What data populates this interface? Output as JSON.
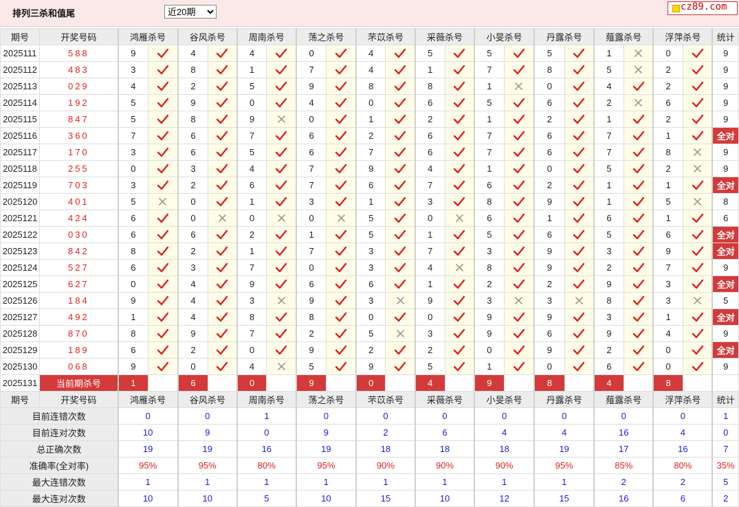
{
  "header": {
    "title": "排列三杀和值尾",
    "period_select": {
      "selected": "近20期",
      "options": [
        "近20期"
      ]
    },
    "logo_text": "cz89.com"
  },
  "columns": {
    "period": "期号",
    "draw": "开奖号码",
    "experts": [
      "鸿雁杀号",
      "谷风杀号",
      "周南杀号",
      "荡之杀号",
      "芣苡杀号",
      "采薇杀号",
      "小旻杀号",
      "丹露杀号",
      "薤露杀号",
      "浮萍杀号"
    ],
    "stat": "统计"
  },
  "rows": [
    {
      "period": "2025111",
      "draw": "588",
      "kills": [
        9,
        4,
        4,
        0,
        4,
        5,
        5,
        5,
        1,
        0
      ],
      "marks": [
        1,
        1,
        1,
        1,
        1,
        1,
        1,
        1,
        0,
        1
      ],
      "stat": "9"
    },
    {
      "period": "2025112",
      "draw": "483",
      "kills": [
        3,
        8,
        1,
        7,
        4,
        1,
        7,
        8,
        5,
        2
      ],
      "marks": [
        1,
        1,
        1,
        1,
        1,
        1,
        1,
        1,
        0,
        1
      ],
      "stat": "9"
    },
    {
      "period": "2025113",
      "draw": "029",
      "kills": [
        4,
        2,
        5,
        9,
        8,
        8,
        1,
        0,
        4,
        2
      ],
      "marks": [
        1,
        1,
        1,
        1,
        1,
        1,
        0,
        1,
        1,
        1
      ],
      "stat": "9"
    },
    {
      "period": "2025114",
      "draw": "192",
      "kills": [
        5,
        9,
        0,
        4,
        0,
        6,
        5,
        6,
        2,
        6
      ],
      "marks": [
        1,
        1,
        1,
        1,
        1,
        1,
        1,
        1,
        0,
        1
      ],
      "stat": "9"
    },
    {
      "period": "2025115",
      "draw": "847",
      "kills": [
        5,
        8,
        9,
        0,
        1,
        2,
        1,
        2,
        1,
        2
      ],
      "marks": [
        1,
        1,
        0,
        1,
        1,
        1,
        1,
        1,
        1,
        1
      ],
      "stat": "9"
    },
    {
      "period": "2025116",
      "draw": "360",
      "kills": [
        7,
        6,
        7,
        6,
        2,
        6,
        7,
        6,
        7,
        1
      ],
      "marks": [
        1,
        1,
        1,
        1,
        1,
        1,
        1,
        1,
        1,
        1
      ],
      "stat": "全对"
    },
    {
      "period": "2025117",
      "draw": "170",
      "kills": [
        3,
        6,
        5,
        6,
        7,
        6,
        7,
        6,
        7,
        8
      ],
      "marks": [
        1,
        1,
        1,
        1,
        1,
        1,
        1,
        1,
        1,
        0
      ],
      "stat": "9"
    },
    {
      "period": "2025118",
      "draw": "255",
      "kills": [
        0,
        3,
        4,
        7,
        9,
        4,
        1,
        0,
        5,
        2
      ],
      "marks": [
        1,
        1,
        1,
        1,
        1,
        1,
        1,
        1,
        1,
        0
      ],
      "stat": "9"
    },
    {
      "period": "2025119",
      "draw": "703",
      "kills": [
        3,
        2,
        6,
        7,
        6,
        7,
        6,
        2,
        1,
        1
      ],
      "marks": [
        1,
        1,
        1,
        1,
        1,
        1,
        1,
        1,
        1,
        1
      ],
      "stat": "全对"
    },
    {
      "period": "2025120",
      "draw": "401",
      "kills": [
        5,
        0,
        1,
        3,
        1,
        3,
        8,
        9,
        1,
        5
      ],
      "marks": [
        0,
        1,
        1,
        1,
        1,
        1,
        1,
        1,
        1,
        0
      ],
      "stat": "8"
    },
    {
      "period": "2025121",
      "draw": "424",
      "kills": [
        6,
        0,
        0,
        0,
        5,
        0,
        6,
        1,
        6,
        1
      ],
      "marks": [
        1,
        0,
        0,
        0,
        1,
        0,
        1,
        1,
        1,
        1
      ],
      "stat": "6"
    },
    {
      "period": "2025122",
      "draw": "030",
      "kills": [
        6,
        6,
        2,
        1,
        5,
        1,
        5,
        6,
        5,
        6
      ],
      "marks": [
        1,
        1,
        1,
        1,
        1,
        1,
        1,
        1,
        1,
        1
      ],
      "stat": "全对"
    },
    {
      "period": "2025123",
      "draw": "842",
      "kills": [
        8,
        2,
        1,
        7,
        3,
        7,
        3,
        9,
        3,
        9
      ],
      "marks": [
        1,
        1,
        1,
        1,
        1,
        1,
        1,
        1,
        1,
        1
      ],
      "stat": "全对"
    },
    {
      "period": "2025124",
      "draw": "527",
      "kills": [
        6,
        3,
        7,
        0,
        3,
        4,
        8,
        9,
        2,
        7
      ],
      "marks": [
        1,
        1,
        1,
        1,
        1,
        0,
        1,
        1,
        1,
        1
      ],
      "stat": "9"
    },
    {
      "period": "2025125",
      "draw": "627",
      "kills": [
        0,
        4,
        9,
        6,
        6,
        1,
        2,
        2,
        9,
        3
      ],
      "marks": [
        1,
        1,
        1,
        1,
        1,
        1,
        1,
        1,
        1,
        1
      ],
      "stat": "全对"
    },
    {
      "period": "2025126",
      "draw": "184",
      "kills": [
        9,
        4,
        3,
        9,
        3,
        9,
        3,
        3,
        8,
        3
      ],
      "marks": [
        1,
        1,
        0,
        1,
        0,
        1,
        0,
        0,
        1,
        0
      ],
      "stat": "5"
    },
    {
      "period": "2025127",
      "draw": "492",
      "kills": [
        1,
        4,
        8,
        8,
        0,
        0,
        9,
        9,
        3,
        1
      ],
      "marks": [
        1,
        1,
        1,
        1,
        1,
        1,
        1,
        1,
        1,
        1
      ],
      "stat": "全对"
    },
    {
      "period": "2025128",
      "draw": "870",
      "kills": [
        8,
        9,
        7,
        2,
        5,
        3,
        9,
        6,
        9,
        4
      ],
      "marks": [
        1,
        1,
        1,
        1,
        0,
        1,
        1,
        1,
        1,
        1
      ],
      "stat": "9"
    },
    {
      "period": "2025129",
      "draw": "189",
      "kills": [
        6,
        2,
        0,
        9,
        2,
        2,
        0,
        9,
        2,
        0
      ],
      "marks": [
        1,
        1,
        1,
        1,
        1,
        1,
        1,
        1,
        1,
        1
      ],
      "stat": "全对"
    },
    {
      "period": "2025130",
      "draw": "068",
      "kills": [
        9,
        0,
        4,
        5,
        9,
        5,
        1,
        0,
        6,
        0
      ],
      "marks": [
        1,
        1,
        0,
        1,
        1,
        1,
        1,
        1,
        1,
        1
      ],
      "stat": "9"
    }
  ],
  "current": {
    "period": "2025131",
    "label": "当前期杀号",
    "kills": [
      "1",
      "6",
      "0",
      "9",
      "0",
      "4",
      "9",
      "8",
      "4",
      "8"
    ]
  },
  "summary": [
    {
      "label": "目前连错次数",
      "values": [
        "0",
        "0",
        "1",
        "0",
        "0",
        "0",
        "0",
        "0",
        "0",
        "0",
        "1"
      ],
      "color": "blue"
    },
    {
      "label": "目前连对次数",
      "values": [
        "10",
        "9",
        "0",
        "9",
        "2",
        "6",
        "4",
        "4",
        "16",
        "4",
        "0"
      ],
      "color": "blue"
    },
    {
      "label": "总正确次数",
      "values": [
        "19",
        "19",
        "16",
        "19",
        "18",
        "18",
        "18",
        "19",
        "17",
        "16",
        "7"
      ],
      "color": "blue"
    },
    {
      "label": "准确率(全对率)",
      "values": [
        "95%",
        "95%",
        "80%",
        "95%",
        "90%",
        "90%",
        "90%",
        "95%",
        "85%",
        "80%",
        "35%"
      ],
      "color": "red"
    },
    {
      "label": "最大连错次数",
      "values": [
        "1",
        "1",
        "1",
        "1",
        "1",
        "1",
        "1",
        "1",
        "2",
        "2",
        "5"
      ],
      "color": "blue"
    },
    {
      "label": "最大连对次数",
      "values": [
        "10",
        "10",
        "5",
        "10",
        "15",
        "10",
        "12",
        "15",
        "16",
        "6",
        "2"
      ],
      "color": "blue"
    }
  ],
  "colors": {
    "accent": "#d43a3a",
    "check": "#e02020",
    "cross": "#9a9a9a",
    "blue": "#1a1ae0",
    "cell_tint": "#fffde7"
  }
}
